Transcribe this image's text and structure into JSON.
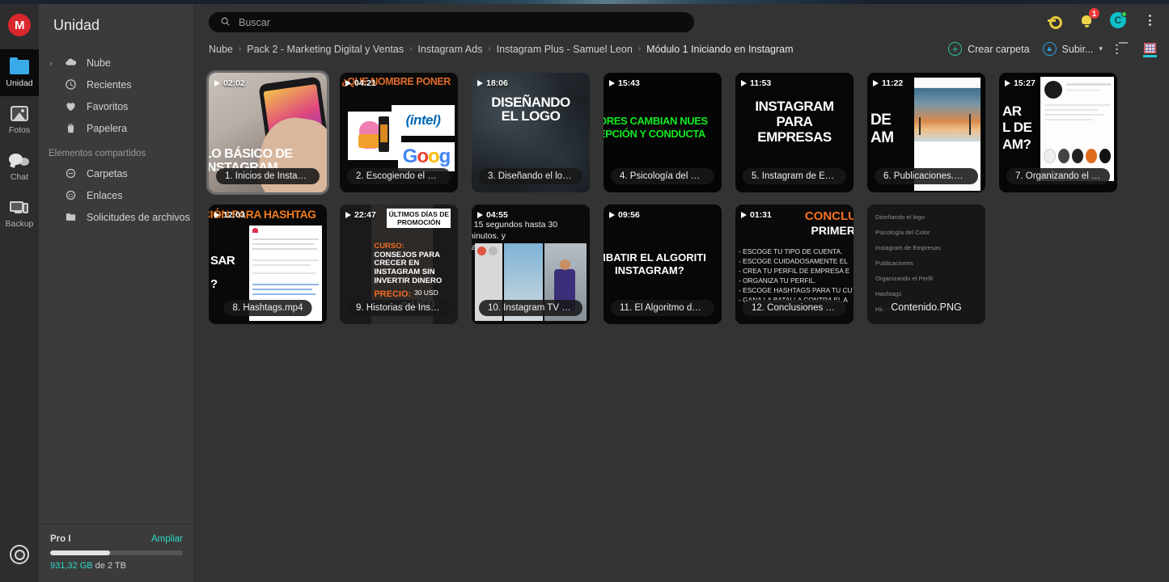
{
  "app": {
    "rail": {
      "logo_label": "M",
      "items": [
        {
          "label": "Unidad",
          "icon": "folder-icon",
          "active": true
        },
        {
          "label": "Fotos",
          "icon": "photos-icon",
          "active": false
        },
        {
          "label": "Chat",
          "icon": "chat-icon",
          "active": false
        },
        {
          "label": "Backup",
          "icon": "backup-icon",
          "active": false
        }
      ],
      "achievements_icon": "achievements-icon"
    },
    "sidebar": {
      "title": "Unidad",
      "items": [
        {
          "label": "Nube",
          "icon": "cloud-icon",
          "caret": "›"
        },
        {
          "label": "Recientes",
          "icon": "clock-icon",
          "caret": ""
        },
        {
          "label": "Favoritos",
          "icon": "heart-icon",
          "caret": ""
        },
        {
          "label": "Papelera",
          "icon": "trash-icon",
          "caret": ""
        }
      ],
      "section_label": "Elementos compartidos",
      "shared_items": [
        {
          "label": "Carpetas",
          "icon": "shared-folders-icon"
        },
        {
          "label": "Enlaces",
          "icon": "link-icon"
        },
        {
          "label": "Solicitudes de archivos",
          "icon": "file-request-icon"
        }
      ],
      "storage": {
        "plan": "Pro I",
        "upgrade_label": "Ampliar",
        "used": "931,32 GB",
        "of_label": "de 2 TB",
        "percent": 45,
        "accent": "#2bd9c7"
      }
    },
    "search": {
      "placeholder": "Buscar",
      "value": "",
      "icon": "search-icon"
    },
    "topbar_icons": [
      {
        "name": "key-icon",
        "label": ""
      },
      {
        "name": "notifications-bell-icon",
        "badge": "1"
      },
      {
        "name": "avatar",
        "label": "C",
        "status": "online"
      },
      {
        "name": "kebab-menu-icon",
        "label": ""
      }
    ],
    "breadcrumb": [
      "Nube",
      "Pack 2 - Marketing Digital y Ventas",
      "Instagram Ads",
      "Instagram Plus - Samuel Leon",
      "Módulo 1 Iniciando en Instagram"
    ],
    "breadcrumb_separator": "›",
    "actions": {
      "create_folder": "Crear carpeta",
      "create_folder_icon": "plus-circle-icon",
      "upload": "Subir...",
      "upload_icon": "upload-circle-icon",
      "upload_caret": "▾",
      "view_list_icon": "list-view-icon",
      "view_grid_icon": "grid-view-icon",
      "active_view": "grid"
    },
    "files": [
      {
        "index": 1,
        "name": "1. Inicios de Instagra...",
        "duration": "02:02",
        "type": "video",
        "selected": true,
        "thumb_text": "LO BÁSICO DE INSTAGRAM"
      },
      {
        "index": 2,
        "name": "2. Escogiendo el nom...",
        "duration": "04:21",
        "type": "video",
        "selected": false,
        "thumb_text": "¿QUE NOMBRE PONER"
      },
      {
        "index": 3,
        "name": "3. Diseñando el logo...",
        "duration": "18:06",
        "type": "video",
        "selected": false,
        "thumb_text": "DISEÑANDO EL LOGO"
      },
      {
        "index": 4,
        "name": "4. Psicología del Color...",
        "duration": "15:43",
        "type": "video",
        "selected": false,
        "thumb_text": "ORES CAMBIAN NUES EPCIÓN Y CONDUCTA"
      },
      {
        "index": 5,
        "name": "5. Instagram de Empr...",
        "duration": "11:53",
        "type": "video",
        "selected": false,
        "thumb_text": "INSTAGRAM PARA EMPRESAS"
      },
      {
        "index": 6,
        "name": "6. Publicaciones.mp4",
        "duration": "11:22",
        "type": "video",
        "selected": false,
        "thumb_text": "DE AM"
      },
      {
        "index": 7,
        "name": "7. Organizando el Per...",
        "duration": "15:27",
        "type": "video",
        "selected": false,
        "thumb_text": "AR L DE AM?"
      },
      {
        "index": 8,
        "name": "8. Hashtags.mp4",
        "duration": "12:03",
        "type": "video",
        "selected": false,
        "thumb_text": "CIÓN PARA HASHTAG SAR ?"
      },
      {
        "index": 9,
        "name": "9. Historias de Instagr...",
        "duration": "22:47",
        "type": "video",
        "selected": false,
        "thumb_text": "ÚLTIMOS DÍAS DE PROMOCIÓN"
      },
      {
        "index": 10,
        "name": "10. Instagram TV (IGT...",
        "duration": "04:55",
        "type": "video",
        "selected": false,
        "thumb_text": "e 15 segundos hasta 30 minutos. y das."
      },
      {
        "index": 11,
        "name": "11. El Algoritmo de In...",
        "duration": "09:56",
        "type": "video",
        "selected": false,
        "thumb_text": "MBATIR EL ALGORITI INSTAGRAM?"
      },
      {
        "index": 12,
        "name": "12. Conclusiones Pri...",
        "duration": "01:31",
        "type": "video",
        "selected": false,
        "thumb_text": "CONCLU PRIMER"
      },
      {
        "index": 13,
        "name": "Contenido.PNG",
        "duration": "",
        "type": "image",
        "selected": false,
        "thumb_text": ""
      }
    ],
    "thumb_content": {
      "c2_title": "QUE NOMBRE PONER",
      "c2_title_prefix": "¿",
      "c2_intel": "(intel)",
      "c2_goog": "Goog",
      "c3_line1": "DISEÑANDO",
      "c3_line2": "EL LOGO",
      "c4_line1": "ORES CAMBIAN NUES",
      "c4_line2": "EPCIÓN Y CONDUCTA",
      "c5_line1": "INSTAGRAM",
      "c5_line2": "PARA",
      "c5_line3": "EMPRESAS",
      "c6_line1": "DE",
      "c6_line2": "AM",
      "c7_line1": "AR",
      "c7_line2": "L DE",
      "c7_line3": "AM?",
      "c8_title": "CIÓN PARA HASHTAG",
      "c8_line1": "SAR",
      "c8_line2": "?",
      "c9_chip1": "ÚLTIMOS DÍAS DE",
      "c9_chip2": "PROMOCIÓN",
      "c9_l1": "CURSO:",
      "c9_l2": "CONSEJOS PARA",
      "c9_l3": "CRECER EN",
      "c9_l4": "INSTAGRAM SIN",
      "c9_l5": "INVERTIR DINERO",
      "c9_price": "PRECIO:",
      "c9_usd": "30 USD",
      "c9_ousd": "o USD",
      "c10_l1": "e 15 segundos hasta 30 minutos. y",
      "c10_l2": "das.",
      "c11_l1": "MBATIR EL ALGORITI",
      "c11_l2": "INSTAGRAM?",
      "c12_h1": "CONCLU",
      "c12_h2": "PRIMER",
      "c12_items": [
        "- ESCOGE TU TIPO DE CUENTA.",
        "- ESCOGE CUIDADOSAMENTE EL",
        "- CREA TU PERFIL DE EMPRESA E",
        "- ORGANIZA TU PERFIL.",
        "- ESCOGE HASHTAGS PARA TU CU",
        "- GANA LA BATALLA CONTRA EL A"
      ],
      "c13_items": [
        "Diseñando el logo",
        "Psicología del Color",
        "Instagram de Empresas",
        "Publicaciones",
        "Organizando el Perfil",
        "Hashtags",
        "Histo"
      ]
    }
  }
}
